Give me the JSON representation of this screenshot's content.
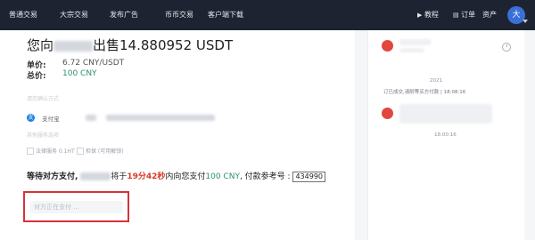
{
  "nav": {
    "items": [
      "普通交易",
      "大宗交易",
      "发布广告",
      "币币交易",
      "客户端下载"
    ],
    "tutorial": "教程",
    "orders": "订单",
    "assets": "资产",
    "avatar_initial": "大"
  },
  "order": {
    "title_prefix": "您向",
    "title_suffix": "出售14.880952 USDT",
    "unit_price_label": "单价:",
    "unit_price_value": "6.72 CNY/USDT",
    "total_label": "总价:",
    "total_value": "100 CNY",
    "payment_method_label": "请您确认方式",
    "alipay_label": "支付宝",
    "services_label": "其他服务选项",
    "option1": "法律服务 0.1HT",
    "option2": "担保 (可用解锁)",
    "wait_prefix": "等待对方支付,",
    "wait_mid": "将于",
    "countdown": "19分42秒",
    "wait_after_time": "内向您支付",
    "wait_amount": "100 CNY",
    "ref_label": ", 付款参考号 :",
    "ref_code": "434990",
    "waiting_button": "对方正在支付 ..."
  },
  "chat": {
    "date_line": "2021",
    "system_message": "订已成交,请耐等买方付款 | 18:08:16",
    "time_stamp": "18:00:16"
  },
  "colors": {
    "topbar": "#1d2331",
    "accent_green": "#2e8d6f",
    "countdown_red": "#d83a2b",
    "highlight_box": "#d8323a"
  }
}
